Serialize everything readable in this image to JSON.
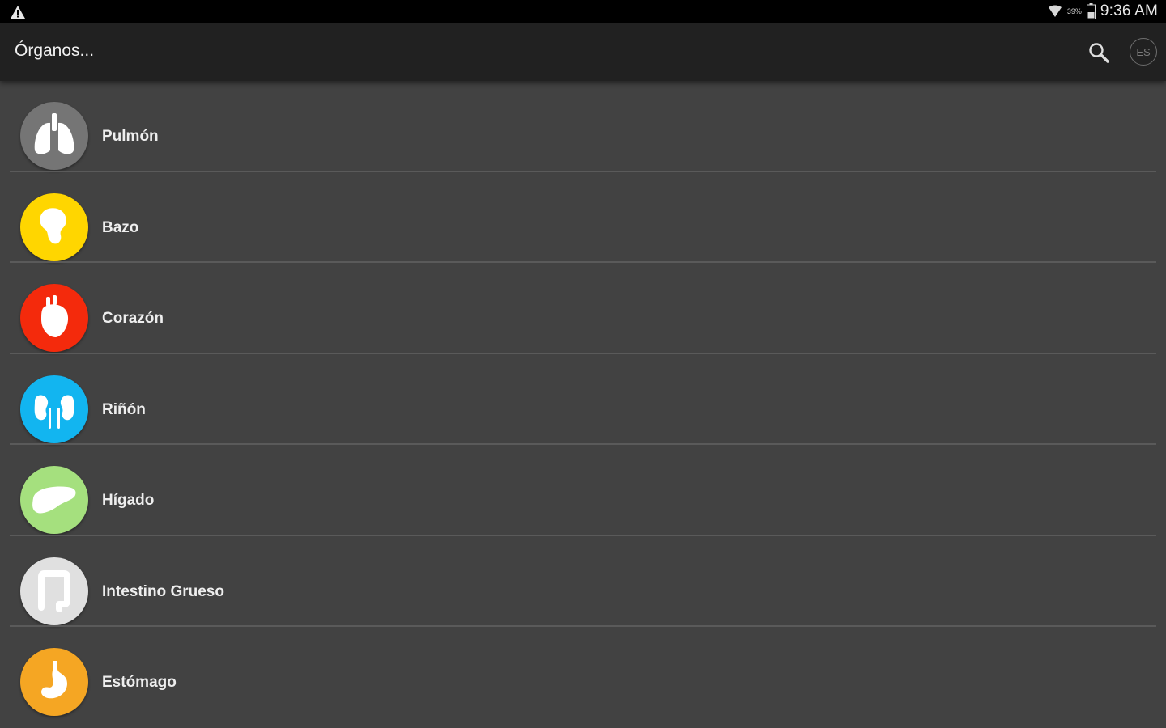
{
  "status_bar": {
    "battery_percent": "39%",
    "time": "9:36 AM"
  },
  "app_bar": {
    "title": "Órganos...",
    "language_label": "ES"
  },
  "organs": [
    {
      "label": "Pulmón",
      "color": "#757575",
      "icon": "lungs-icon"
    },
    {
      "label": "Bazo",
      "color": "#ffd600",
      "icon": "spleen-icon"
    },
    {
      "label": "Corazón",
      "color": "#f42a0c",
      "icon": "heart-icon"
    },
    {
      "label": "Riñón",
      "color": "#12b5f0",
      "icon": "kidneys-icon"
    },
    {
      "label": "Hígado",
      "color": "#a5e07e",
      "icon": "liver-icon"
    },
    {
      "label": "Intestino Grueso",
      "color": "#e0e0e0",
      "icon": "large-intestine-icon"
    },
    {
      "label": "Estómago",
      "color": "#f5a623",
      "icon": "stomach-icon"
    }
  ]
}
